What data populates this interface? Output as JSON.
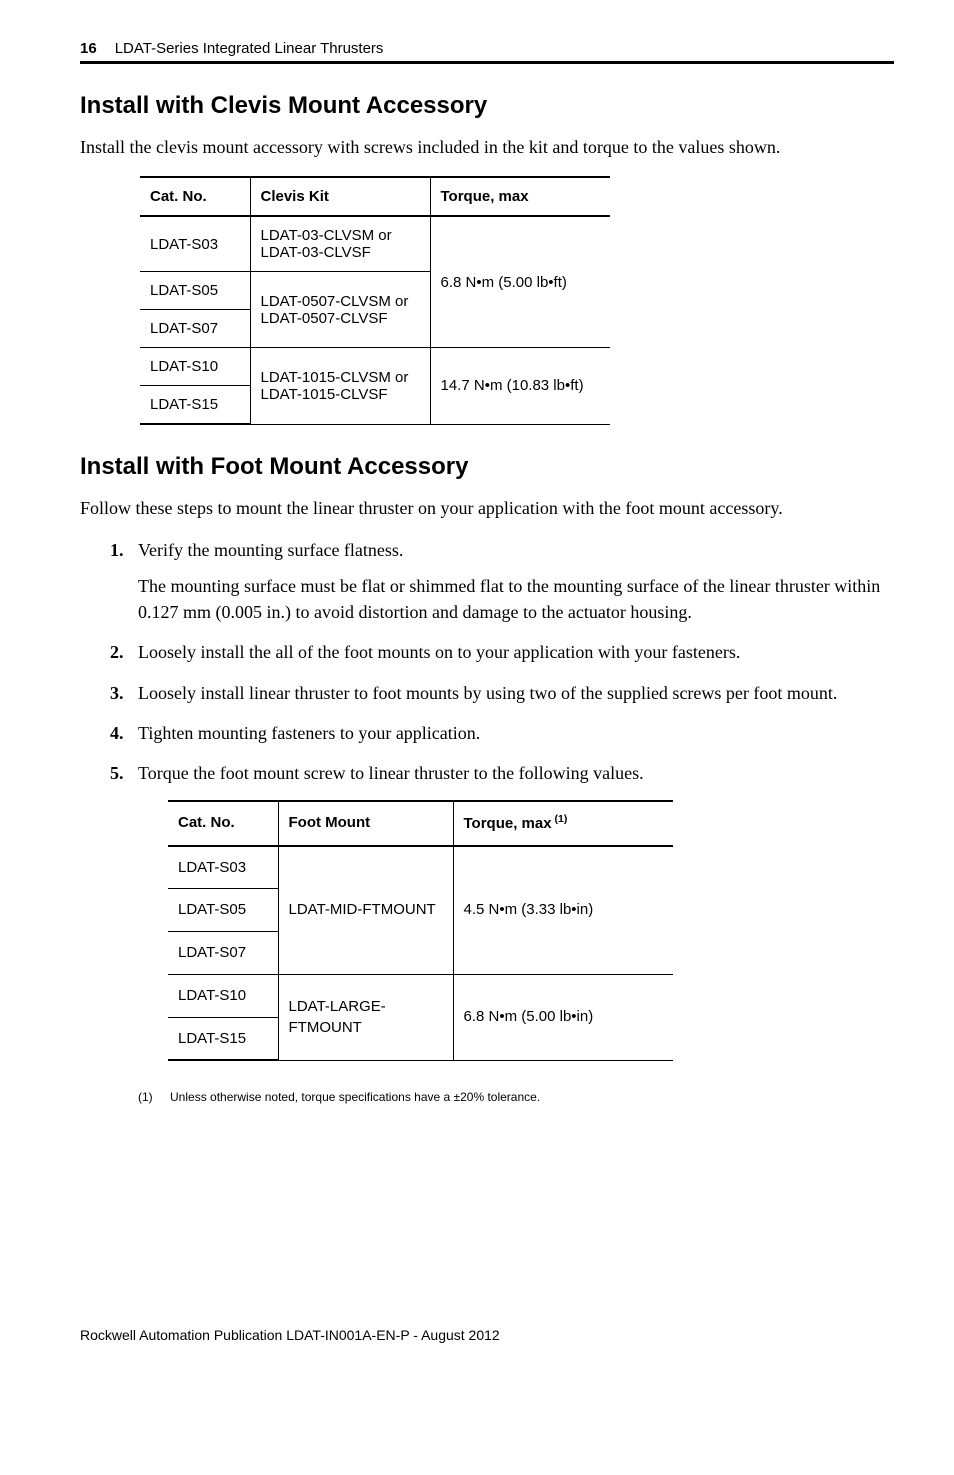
{
  "header": {
    "page_number": "16",
    "publication_title": "LDAT-Series Integrated Linear Thrusters"
  },
  "section1": {
    "heading": "Install with Clevis Mount Accessory",
    "intro": "Install the clevis mount accessory with screws included in the kit and torque to the values shown.",
    "table": {
      "headers": {
        "catno": "Cat. No.",
        "kit": "Clevis Kit",
        "torque": "Torque, max"
      },
      "rows": [
        {
          "catno": "LDAT-S03",
          "kit": "LDAT-03-CLVSM or LDAT-03-CLVSF"
        },
        {
          "catno": "LDAT-S05",
          "kit_top": "LDAT-0507-CLVSM or"
        },
        {
          "catno": "LDAT-S07",
          "kit_bot": "LDAT-0507-CLVSF"
        },
        {
          "catno": "LDAT-S10",
          "kit_top2": "LDAT-1015-CLVSM or"
        },
        {
          "catno": "LDAT-S15",
          "kit_bot2": "LDAT-1015-CLVSF"
        }
      ],
      "kit_0507": "LDAT-0507-CLVSM or LDAT-0507-CLVSF",
      "kit_1015": "LDAT-1015-CLVSM or LDAT-1015-CLVSF",
      "torque1": "6.8 N•m (5.00 lb•ft)",
      "torque2": "14.7 N•m (10.83 lb•ft)"
    }
  },
  "section2": {
    "heading": "Install with Foot Mount Accessory",
    "intro": "Follow these steps to mount the linear thruster on your application with the foot mount accessory.",
    "steps": {
      "s1": "Verify the mounting surface flatness.",
      "s1_sub": "The mounting surface must be flat or shimmed flat to the mounting surface of the linear thruster within 0.127 mm (0.005 in.) to avoid distortion and damage to the actuator housing.",
      "s2": "Loosely install the all of the foot mounts on to your application with your fasteners.",
      "s3": "Loosely install linear thruster to foot mounts by using two of the supplied screws per foot mount.",
      "s4": "Tighten mounting fasteners to your application.",
      "s5": "Torque the foot mount screw to linear thruster to the following values."
    },
    "table": {
      "headers": {
        "catno": "Cat. No.",
        "foot": "Foot Mount",
        "torque_pre": "Torque, max",
        "torque_sup": " (1)"
      },
      "rows": {
        "r1": "LDAT-S03",
        "r2": "LDAT-S05",
        "r3": "LDAT-S07",
        "r4": "LDAT-S10",
        "r5": "LDAT-S15"
      },
      "foot_mid": "LDAT-MID-FTMOUNT",
      "foot_large": "LDAT-LARGE-FTMOUNT",
      "torque1": "4.5 N•m (3.33 lb•in)",
      "torque2": "6.8 N•m (5.00 lb•in)"
    },
    "footnote": {
      "num": "(1)",
      "text": "Unless otherwise noted, torque specifications have a ±20% tolerance."
    }
  },
  "footer": {
    "text": "Rockwell Automation Publication LDAT-IN001A-EN-P - August 2012"
  }
}
